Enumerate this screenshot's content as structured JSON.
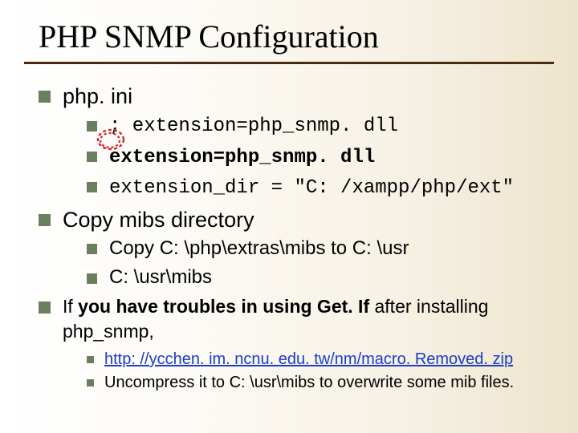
{
  "title": "PHP SNMP Configuration",
  "bullets": {
    "phpini": {
      "label": "php. ini",
      "l1": "; extension=php_snmp. dll",
      "l2": "extension=php_snmp. dll",
      "l3": "extension_dir = \"C: /xampp/php/ext\""
    },
    "copy": {
      "label": "Copy mibs directory",
      "c1": "Copy C: \\php\\extras\\mibs to C: \\usr",
      "c2": "C: \\usr\\mibs"
    },
    "troubles": {
      "prefix": "If ",
      "bold": "you have troubles in using Get. If",
      "suffix": " after installing php_snmp,",
      "t1": "http: //ycchen. im. ncnu. edu. tw/nm/macro. Removed. zip",
      "t2": "Uncompress it to C: \\usr\\mibs to overwrite some mib files."
    }
  }
}
